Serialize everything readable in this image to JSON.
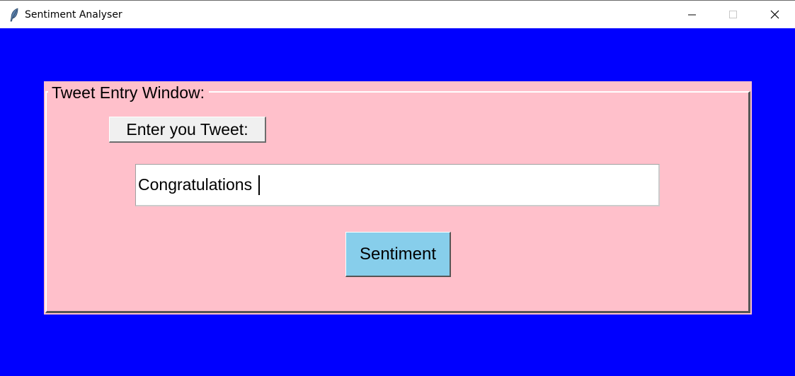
{
  "window": {
    "title": "Sentiment Analyser",
    "app_icon": "feather-icon",
    "controls": {
      "minimize_icon": "minimize-icon",
      "maximize_icon": "maximize-icon",
      "close_icon": "close-icon"
    }
  },
  "frame": {
    "legend": "Tweet Entry Window:"
  },
  "form": {
    "prompt_label": "Enter you Tweet:",
    "tweet_value": "Congratulations",
    "submit_label": "Sentiment"
  },
  "colors": {
    "client_background": "#0000ff",
    "frame_background": "#ffc0cb",
    "submit_button": "#87ceeb",
    "prompt_button": "#f0f0f0"
  }
}
